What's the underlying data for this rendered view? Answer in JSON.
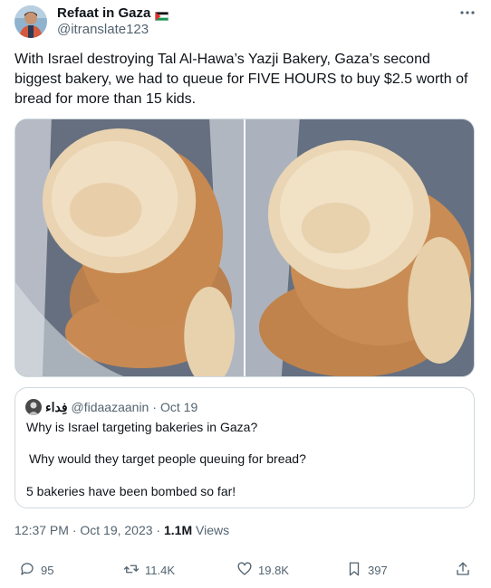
{
  "author": {
    "display_name": "Refaat in Gaza",
    "handle": "@itranslate123"
  },
  "tweet": {
    "text": "With Israel destroying Tal Al-Hawa’s Yazji Bakery, Gaza’s second biggest bakery, we had to queue for FIVE HOURS to buy $2.5 worth of bread for more than 15 kids."
  },
  "quote": {
    "name": "فِداء",
    "handle": "@fidaazaanin",
    "separator": "·",
    "date": "Oct 19",
    "line1": "Why is Israel targeting bakeries in Gaza?",
    "line2": "Why would they target people queuing for bread?",
    "line3": "5 bakeries have been bombed so far!"
  },
  "meta": {
    "timestamp": "12:37 PM · Oct 19, 2023 · ",
    "views_count": "1.1M",
    "views_label": " Views"
  },
  "actions": {
    "replies": "95",
    "reposts": "11.4K",
    "likes": "19.8K",
    "bookmarks": "397"
  },
  "colors": {
    "text": "#0f1419",
    "secondary": "#536471",
    "border": "#cfd9de"
  },
  "icons": [
    "more-icon",
    "flag-icon",
    "reply-icon",
    "repost-icon",
    "like-icon",
    "bookmark-icon",
    "share-icon"
  ]
}
